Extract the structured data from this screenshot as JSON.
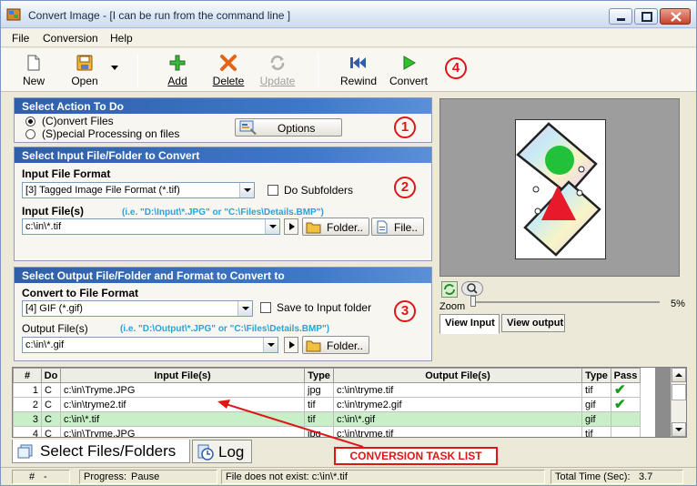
{
  "window": {
    "title": "Convert Image - [I can be run from the command line ]"
  },
  "menu": [
    "File",
    "Conversion",
    "Help"
  ],
  "toolbar": {
    "new": "New",
    "open": "Open",
    "add": "Add",
    "delete": "Delete",
    "update": "Update",
    "rewind": "Rewind",
    "convert": "Convert"
  },
  "badges": [
    "1",
    "2",
    "3",
    "4"
  ],
  "action": {
    "header": "Select Action To Do",
    "convert_files": "(C)onvert Files",
    "special_processing": "(S)pecial Processing on files",
    "options": "Options"
  },
  "input": {
    "header": "Select Input File/Folder to Convert",
    "format_label": "Input File Format",
    "format_value": "[3] Tagged Image File Format (*.tif)",
    "do_subfolders": "Do Subfolders",
    "files_label": "Input File(s)",
    "hint": "(i.e. \"D:\\Input\\*.JPG\"  or  \"C:\\Files\\Details.BMP\")",
    "files_value": "c:\\in\\*.tif",
    "folder_button": "Folder..",
    "file_button": "File.."
  },
  "output": {
    "header": "Select Output File/Folder and Format to Convert to",
    "format_label": "Convert to File Format",
    "format_value": "[4] GIF (*.gif)",
    "save_to_input": "Save to Input folder",
    "files_label": "Output File(s)",
    "hint": "(i.e. \"D:\\Output\\*.JPG\"  or  \"C:\\Files\\Details.BMP\")",
    "files_value": "c:\\in\\*.gif",
    "folder_button": "Folder.."
  },
  "preview": {
    "zoom_label": "Zoom",
    "zoom_value": "5%",
    "zoom_level": 0.05,
    "tab_input": "View Input",
    "tab_output": "View output"
  },
  "table": {
    "headers": [
      "#",
      "Do",
      "Input File(s)",
      "Type",
      "Output File(s)",
      "Type",
      "Pass"
    ],
    "rows": [
      [
        "1",
        "C",
        "c:\\in\\Tryme.JPG",
        "jpg",
        "c:\\in\\tryme.tif",
        "tif",
        "✔"
      ],
      [
        "2",
        "C",
        "c:\\in\\tryme2.tif",
        "tif",
        "c:\\in\\tryme2.gif",
        "gif",
        "✔"
      ],
      [
        "3",
        "C",
        "c:\\in\\*.tif",
        "tif",
        "c:\\in\\*.gif",
        "gif",
        ""
      ],
      [
        "4",
        "C",
        "c:\\in\\Tryme.JPG",
        "jpg",
        "c:\\in\\tryme.tif",
        "tif",
        ""
      ]
    ],
    "selected_row": 2
  },
  "bottom_tabs": {
    "files": "Select Files/Folders",
    "log": "Log"
  },
  "callout": "CONVERSION TASK LIST",
  "status": {
    "hash_label": "#",
    "hash_value": "-",
    "progress_label": "Progress:",
    "progress_value": "Pause",
    "message": "File does not exist: c:\\in\\*.tif",
    "total_label": "Total Time (Sec):",
    "total_value": "3.7"
  },
  "colors": {
    "header_blue": "#2f5fa8",
    "badge_red": "#e01515",
    "selected_row": "#c8efc8",
    "hint_cyan": "#2aa2d8"
  }
}
